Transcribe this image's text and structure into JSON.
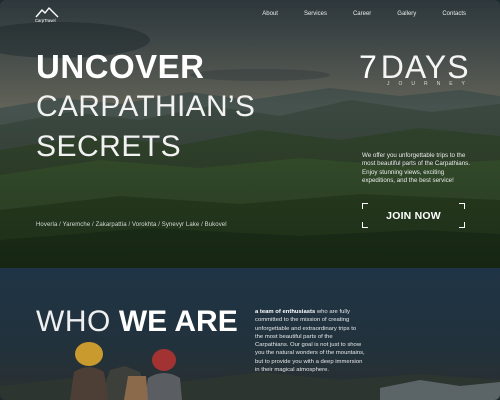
{
  "brand": {
    "logo_text": "CarpTravel"
  },
  "nav": {
    "items": [
      "About",
      "Services",
      "Career",
      "Gallery",
      "Contacts"
    ]
  },
  "hero": {
    "headline_bold": "UNCOVER",
    "headline_line2": "CARPATHIAN’S",
    "headline_line3": "SECRETS",
    "days_number": "7",
    "days_word": "DAYS",
    "journey": "JOURNEY",
    "description": "We offer you unforgettable trips to the most beautiful parts of the Carpathians. Enjoy stunning views, exciting expeditions, and the best service!",
    "cta_label": "JOIN NOW",
    "locations": "Hoverla / Yaremche / Zakarpattia / Vorokhta / Synevyr Lake / Bukovel"
  },
  "who": {
    "title_light": "WHO",
    "title_bold": "WE ARE",
    "text_bold": "a team of enthusiasts",
    "text_rest": " who are fully committed to the mission of creating unforgettable and extraordinary trips to the most beautiful parts of the Carpathians. Our goal is not just to show you the natural wonders of the mountains, but to provide you with a deep immersion in their magical atmosphere."
  },
  "colors": {
    "sky_top": "#3c4c52",
    "sky_warm": "#8a7a62",
    "valley": "#2b4a2c",
    "who_bg": "#1e2c38"
  }
}
